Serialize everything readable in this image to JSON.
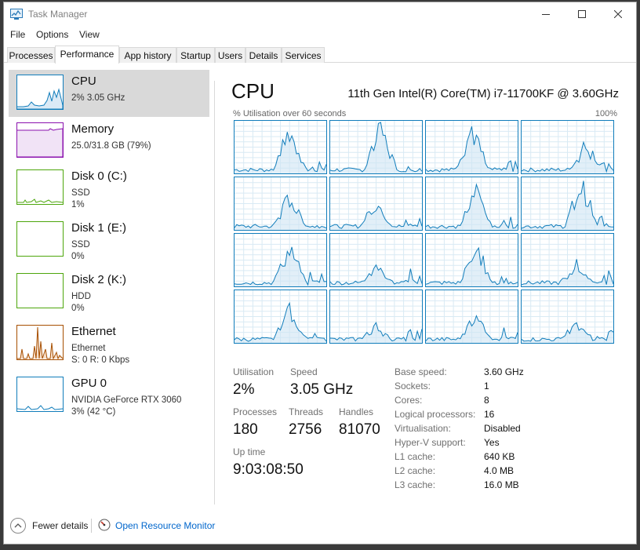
{
  "window": {
    "title": "Task Manager"
  },
  "menu": [
    "File",
    "Options",
    "View"
  ],
  "tabs": [
    {
      "label": "Processes",
      "active": false
    },
    {
      "label": "Performance",
      "active": true
    },
    {
      "label": "App history",
      "active": false
    },
    {
      "label": "Startup",
      "active": false
    },
    {
      "label": "Users",
      "active": false
    },
    {
      "label": "Details",
      "active": false
    },
    {
      "label": "Services",
      "active": false
    }
  ],
  "sidebar": {
    "items": [
      {
        "title": "CPU",
        "line1": "2% 3.05 GHz",
        "line2": "",
        "line3": "",
        "color": "#117dbb",
        "fill": "#f1f6fa",
        "selected": true
      },
      {
        "title": "Memory",
        "line1": "25.0/31.8 GB (79%)",
        "line2": "",
        "line3": "",
        "color": "#8b12ae",
        "fill": "#f4eaf7",
        "selected": false
      },
      {
        "title": "Disk 0 (C:)",
        "line1": "SSD",
        "line2": "1%",
        "line3": "",
        "color": "#4da60c",
        "fill": "#eff7e9",
        "selected": false
      },
      {
        "title": "Disk 1 (E:)",
        "line1": "SSD",
        "line2": "0%",
        "line3": "",
        "color": "#4da60c",
        "fill": "#eff7e9",
        "selected": false
      },
      {
        "title": "Disk 2 (K:)",
        "line1": "HDD",
        "line2": "0%",
        "line3": "",
        "color": "#4da60c",
        "fill": "#eff7e9",
        "selected": false
      },
      {
        "title": "Ethernet",
        "line1": "Ethernet",
        "line2": "S: 0 R: 0 Kbps",
        "line3": "",
        "color": "#a74f01",
        "fill": "#fcf3eb",
        "selected": false
      },
      {
        "title": "GPU 0",
        "line1": "NVIDIA GeForce RTX 3060",
        "line2": "3% (42 °C)",
        "line3": "",
        "color": "#117dbb",
        "fill": "#f1f6fa",
        "selected": false
      }
    ]
  },
  "main": {
    "title": "CPU",
    "model": "11th Gen Intel(R) Core(TM) i7-11700KF @ 3.60GHz",
    "graph_label": "% Utilisation over 60 seconds",
    "graph_max": "100%",
    "stats": {
      "utilisation_label": "Utilisation",
      "utilisation": "2%",
      "speed_label": "Speed",
      "speed": "3.05 GHz",
      "processes_label": "Processes",
      "processes": "180",
      "threads_label": "Threads",
      "threads": "2756",
      "handles_label": "Handles",
      "handles": "81070",
      "uptime_label": "Up time",
      "uptime": "9:03:08:50"
    },
    "specs": [
      {
        "label": "Base speed:",
        "value": "3.60 GHz"
      },
      {
        "label": "Sockets:",
        "value": "1"
      },
      {
        "label": "Cores:",
        "value": "8"
      },
      {
        "label": "Logical processors:",
        "value": "16"
      },
      {
        "label": "Virtualisation:",
        "value": "Disabled"
      },
      {
        "label": "Hyper-V support:",
        "value": "Yes"
      },
      {
        "label": "L1 cache:",
        "value": "640 KB"
      },
      {
        "label": "L2 cache:",
        "value": "4.0 MB"
      },
      {
        "label": "L3 cache:",
        "value": "16.0 MB"
      }
    ]
  },
  "footer": {
    "fewer_details": "Fewer details",
    "open_resource_monitor": "Open Resource Monitor"
  },
  "colors": {
    "cpu_line": "#117dbb",
    "cpu_fill": "#cfe4f3",
    "grid": "#d9eaf4"
  }
}
